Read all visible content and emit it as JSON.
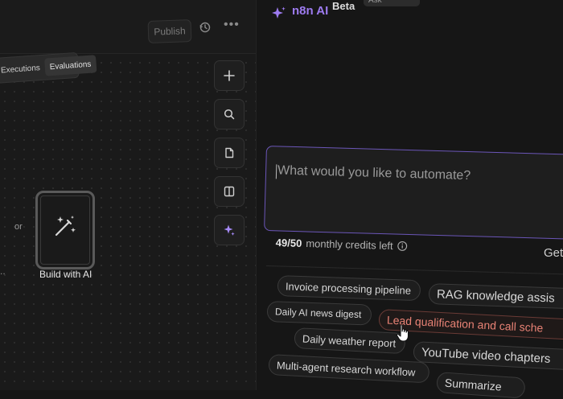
{
  "canvas": {
    "publish_label": "Publish",
    "tabs": [
      {
        "label": "Executions"
      },
      {
        "label": "Evaluations"
      }
    ],
    "or_label": "or",
    "left_fragment": "..",
    "build_card": {
      "label": "Build with AI",
      "icon": "magic-wand-icon"
    },
    "toolbar_icons": [
      "plus-icon",
      "search-icon",
      "document-icon",
      "panel-icon",
      "sparkle-icon"
    ]
  },
  "ai_panel": {
    "title": "n8n AI",
    "badge": "Beta",
    "header_pill": "Ask",
    "prompt": {
      "placeholder": "What would you like to automate?",
      "value": ""
    },
    "credits": {
      "used": "49/50",
      "suffix": "monthly credits left"
    },
    "get_link": "Get",
    "suggestions": [
      {
        "label": "Invoice processing pipeline"
      },
      {
        "label": "RAG knowledge assis"
      },
      {
        "label": "Daily AI news digest"
      },
      {
        "label": "Lead qualification and call sche"
      },
      {
        "label": "Daily weather report"
      },
      {
        "label": "YouTube video chapters"
      },
      {
        "label": "Multi-agent research workflow"
      },
      {
        "label": "Summarize"
      }
    ]
  },
  "colors": {
    "accent_purple": "#9d7bf0",
    "highlight_red": "#e88275",
    "background": "#151515"
  }
}
